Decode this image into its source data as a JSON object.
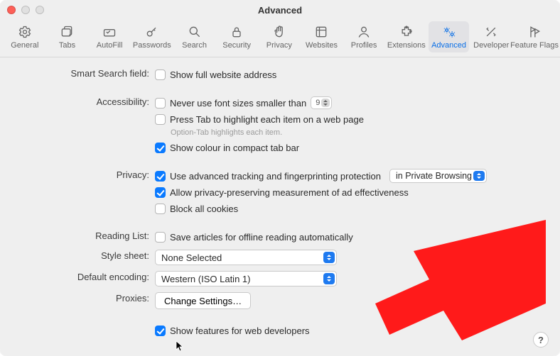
{
  "title": "Advanced",
  "toolbar": [
    {
      "id": "general",
      "label": "General"
    },
    {
      "id": "tabs",
      "label": "Tabs"
    },
    {
      "id": "autofill",
      "label": "AutoFill"
    },
    {
      "id": "passwords",
      "label": "Passwords"
    },
    {
      "id": "search",
      "label": "Search"
    },
    {
      "id": "security",
      "label": "Security"
    },
    {
      "id": "privacy",
      "label": "Privacy"
    },
    {
      "id": "websites",
      "label": "Websites"
    },
    {
      "id": "profiles",
      "label": "Profiles"
    },
    {
      "id": "extensions",
      "label": "Extensions"
    },
    {
      "id": "advanced",
      "label": "Advanced"
    },
    {
      "id": "developer",
      "label": "Developer"
    },
    {
      "id": "featureflags",
      "label": "Feature Flags"
    }
  ],
  "labels": {
    "smart_search": "Smart Search field:",
    "accessibility": "Accessibility:",
    "privacy": "Privacy:",
    "reading_list": "Reading List:",
    "style_sheet": "Style sheet:",
    "default_encoding": "Default encoding:",
    "proxies": "Proxies:"
  },
  "smart_search": {
    "show_full_url": "Show full website address"
  },
  "accessibility": {
    "never_font_sizes": "Never use font sizes smaller than",
    "font_size_value": "9",
    "press_tab": "Press Tab to highlight each item on a web page",
    "press_tab_hint": "Option-Tab highlights each item.",
    "show_colour": "Show colour in compact tab bar"
  },
  "privacy": {
    "tracking": "Use advanced tracking and fingerprinting protection",
    "tracking_mode": "in Private Browsing",
    "measurement": "Allow privacy-preserving measurement of ad effectiveness",
    "block_cookies": "Block all cookies"
  },
  "reading_list": {
    "save_offline": "Save articles for offline reading automatically"
  },
  "style_sheet": {
    "value": "None Selected"
  },
  "default_encoding": {
    "value": "Western (ISO Latin 1)"
  },
  "proxies": {
    "button": "Change Settings…"
  },
  "developers": {
    "show_features": "Show features for web developers"
  },
  "help": "?"
}
